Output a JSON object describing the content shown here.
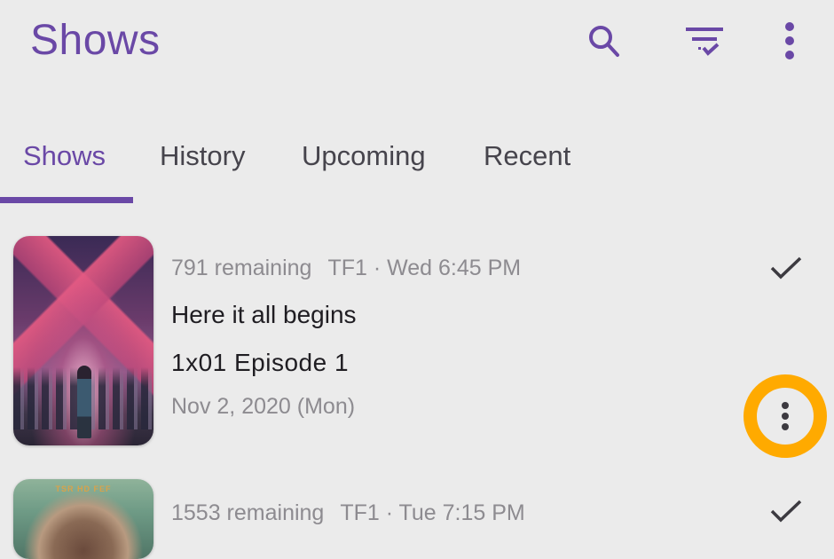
{
  "app_bar": {
    "title": "Shows",
    "actions": [
      {
        "icon": "search-icon",
        "label": "Search"
      },
      {
        "icon": "filter-check-icon",
        "label": "Filter"
      },
      {
        "icon": "more-vert-icon",
        "label": "More options"
      }
    ]
  },
  "tabs": [
    {
      "label": "Shows",
      "active": true
    },
    {
      "label": "History",
      "active": false
    },
    {
      "label": "Upcoming",
      "active": false
    },
    {
      "label": "Recent",
      "active": false
    }
  ],
  "colors": {
    "accent": "#6a48a6",
    "highlight_ring": "#ffaa00",
    "background": "#ebebeb"
  },
  "shows": [
    {
      "remaining": "791 remaining",
      "network_time": "TF1 · Wed 6:45 PM",
      "title": "Here it all begins",
      "episode": "1x01 Episode 1",
      "air_date": "Nov 2, 2020 (Mon)",
      "poster_icon": "show-poster-image",
      "watched_icon": "check-icon",
      "more_icon": "more-vert-icon"
    },
    {
      "remaining": "1553 remaining",
      "network_time": "TF1 · Tue 7:15 PM",
      "poster_caption": "TSR HD FEF",
      "poster_icon": "show-poster-image",
      "watched_icon": "check-icon"
    }
  ]
}
